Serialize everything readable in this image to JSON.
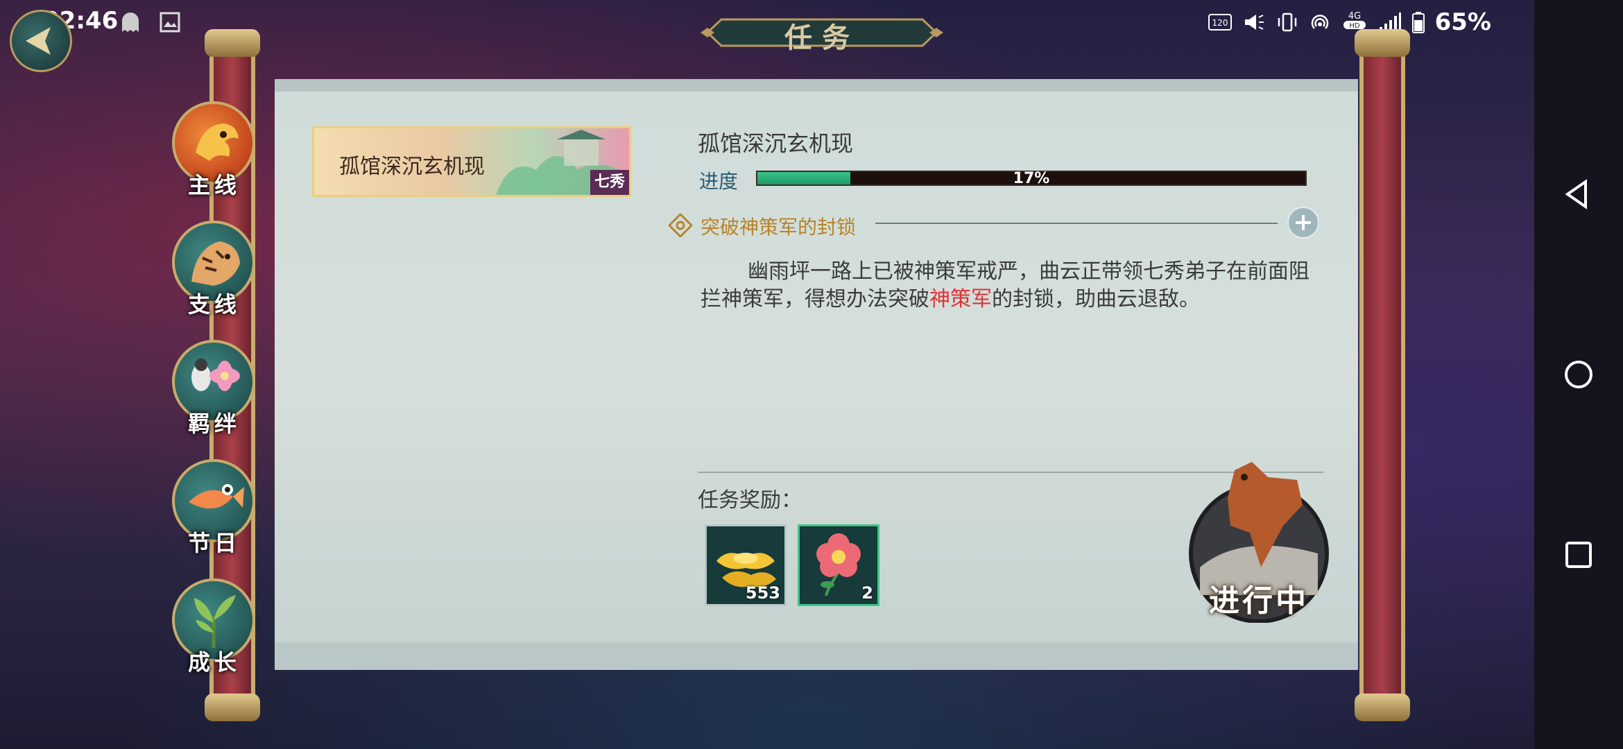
{
  "status_bar": {
    "time": "22:46",
    "battery": "65%",
    "icons": [
      "ghost-icon",
      "image-icon",
      "hd120-icon",
      "speaker-icon",
      "vibrate-icon",
      "hotspot-icon",
      "4g-hd-icon",
      "signal-icon",
      "battery-icon"
    ]
  },
  "header": {
    "title": "任务"
  },
  "categories": [
    {
      "label": "主线",
      "icon": "dragon-icon",
      "color": "#d24a1e"
    },
    {
      "label": "支线",
      "icon": "tiger-icon",
      "color": "#2f6d6a"
    },
    {
      "label": "羁绊",
      "icon": "bird-flower-icon",
      "color": "#2f6d6a"
    },
    {
      "label": "节日",
      "icon": "fish-icon",
      "color": "#2f6d6a"
    },
    {
      "label": "成长",
      "icon": "plant-icon",
      "color": "#2f6d6a"
    }
  ],
  "quest_list": [
    {
      "title": "孤馆深沉玄机现",
      "tag": "七秀"
    }
  ],
  "detail": {
    "title": "孤馆深沉玄机现",
    "progress_label": "进度",
    "progress": 17,
    "progress_text": "17%",
    "step_title": "突破神策军的封锁",
    "description_part1": "幽雨坪一路上已被神策军戒严，曲云正带领七秀弟子在前面阻拦神策军，得想办法突破",
    "description_highlight": "神策军",
    "description_part2": "的封锁，助曲云退敌。",
    "reward_label": "任务奖励：",
    "rewards": [
      {
        "icon": "gold-ingot-icon",
        "count": "553"
      },
      {
        "icon": "peony-flower-icon",
        "count": "2"
      }
    ],
    "status": "进行中"
  },
  "colors": {
    "accent_gold": "#c7ab6c",
    "progress_green": "#39c28a",
    "highlight_red": "#e0323a",
    "step_gold": "#b7842a"
  }
}
